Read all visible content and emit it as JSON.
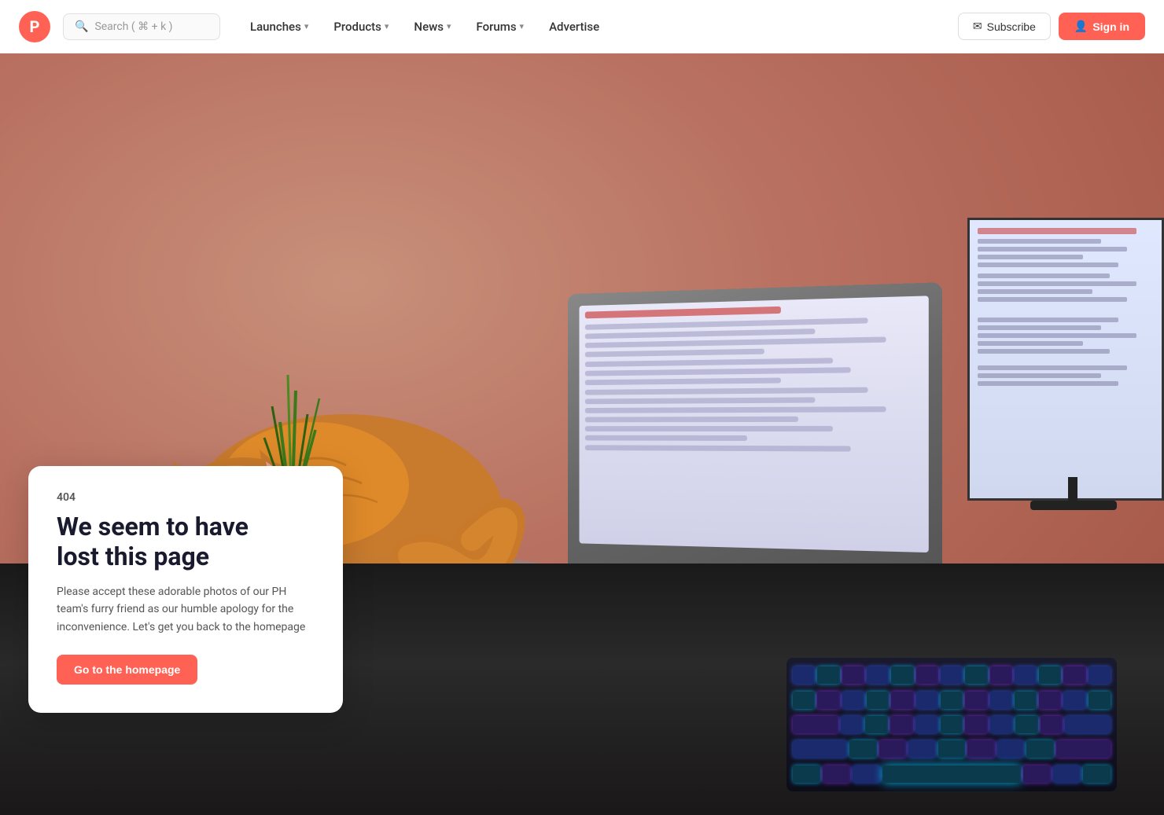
{
  "brand": {
    "logo_letter": "P",
    "logo_color": "#ff6154"
  },
  "nav": {
    "search_placeholder": "Search ( ⌘ + k )",
    "links": [
      {
        "label": "Launches",
        "has_dropdown": true
      },
      {
        "label": "Products",
        "has_dropdown": true
      },
      {
        "label": "News",
        "has_dropdown": true
      },
      {
        "label": "Forums",
        "has_dropdown": true
      },
      {
        "label": "Advertise",
        "has_dropdown": false
      }
    ],
    "subscribe_label": "Subscribe",
    "signin_label": "Sign in"
  },
  "error": {
    "code": "404",
    "title_line1": "We seem to have",
    "title_line2": "lost this page",
    "description": "Please accept these adorable photos of our PH team's furry friend as our humble apology for the inconvenience. Let's get you back to the homepage",
    "cta_label": "Go to the homepage"
  }
}
